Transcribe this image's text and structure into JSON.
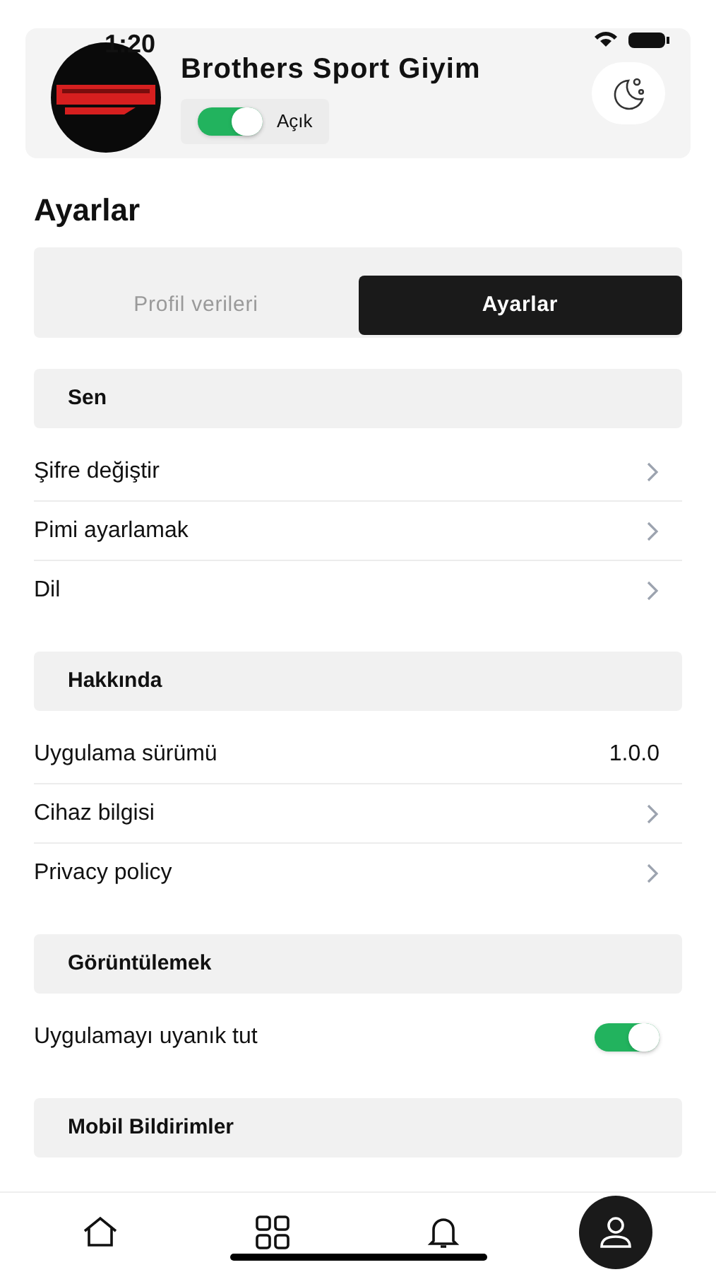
{
  "status_bar": {
    "time": "1:20"
  },
  "header": {
    "title": "Brothers Sport Giyim",
    "switch": {
      "on": true,
      "label": "Açık"
    }
  },
  "page_title": "Ayarlar",
  "tabs": [
    {
      "label": "Profil verileri",
      "selected": false
    },
    {
      "label": "Ayarlar",
      "selected": true
    }
  ],
  "sections": [
    {
      "title": "Sen",
      "rows": [
        {
          "kind": "link",
          "label": "Şifre değiştir"
        },
        {
          "kind": "link",
          "label": "Pimi ayarlamak"
        },
        {
          "kind": "link",
          "label": "Dil"
        }
      ]
    },
    {
      "title": "Hakkında",
      "rows": [
        {
          "kind": "value",
          "label": "Uygulama sürümü",
          "value": "1.0.0"
        },
        {
          "kind": "link",
          "label": "Cihaz bilgisi"
        },
        {
          "kind": "link",
          "label": "Privacy policy"
        }
      ]
    },
    {
      "title": "Görüntülemek",
      "rows": [
        {
          "kind": "toggle",
          "label": "Uygulamayı uyanık tut",
          "on": true
        }
      ]
    },
    {
      "title": "Mobil Bildirimler"
    }
  ],
  "nav": [
    {
      "kind": "home",
      "selected": false
    },
    {
      "kind": "grid",
      "selected": false
    },
    {
      "kind": "bell",
      "selected": false
    },
    {
      "kind": "profile",
      "selected": true
    }
  ]
}
